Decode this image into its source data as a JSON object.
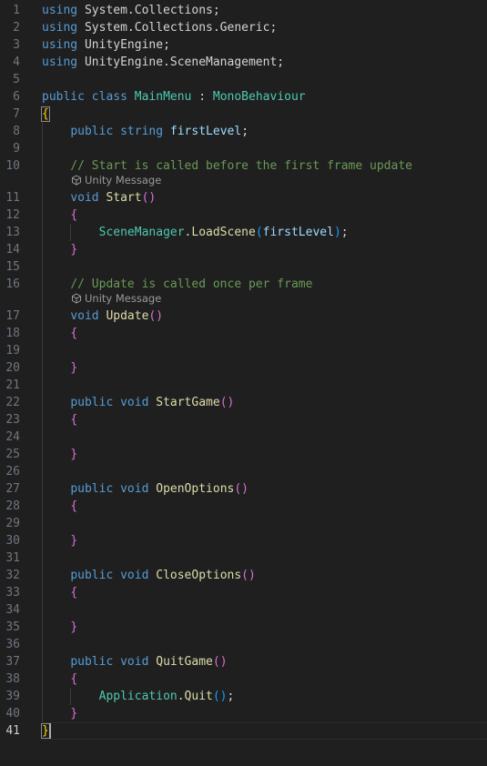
{
  "editor": {
    "active_line": 41,
    "codelens_label": "Unity Message",
    "lines": [
      {
        "n": 1,
        "tokens": [
          [
            "using",
            "kw"
          ],
          [
            " ",
            "pl"
          ],
          [
            "System.Collections",
            "pl"
          ],
          [
            ";",
            "pl"
          ]
        ]
      },
      {
        "n": 2,
        "tokens": [
          [
            "using",
            "kw"
          ],
          [
            " ",
            "pl"
          ],
          [
            "System.Collections.Generic",
            "pl"
          ],
          [
            ";",
            "pl"
          ]
        ]
      },
      {
        "n": 3,
        "tokens": [
          [
            "using",
            "kw"
          ],
          [
            " ",
            "pl"
          ],
          [
            "UnityEngine",
            "pl"
          ],
          [
            ";",
            "pl"
          ]
        ]
      },
      {
        "n": 4,
        "tokens": [
          [
            "using",
            "kw"
          ],
          [
            " ",
            "pl"
          ],
          [
            "UnityEngine.SceneManagement",
            "pl"
          ],
          [
            ";",
            "pl"
          ]
        ]
      },
      {
        "n": 5,
        "tokens": []
      },
      {
        "n": 6,
        "tokens": [
          [
            "public",
            "kw"
          ],
          [
            " ",
            "pl"
          ],
          [
            "class",
            "kw"
          ],
          [
            " ",
            "pl"
          ],
          [
            "MainMenu",
            "ty"
          ],
          [
            " : ",
            "pl"
          ],
          [
            "MonoBehaviour",
            "ty"
          ]
        ]
      },
      {
        "n": 7,
        "tokens": [
          [
            "{",
            "br1 bm"
          ]
        ]
      },
      {
        "n": 8,
        "tokens": [
          [
            "    ",
            "pl"
          ],
          [
            "public",
            "kw"
          ],
          [
            " ",
            "pl"
          ],
          [
            "string",
            "kw"
          ],
          [
            " ",
            "pl"
          ],
          [
            "firstLevel",
            "id"
          ],
          [
            ";",
            "pl"
          ]
        ]
      },
      {
        "n": 9,
        "tokens": []
      },
      {
        "n": 10,
        "tokens": [
          [
            "    ",
            "pl"
          ],
          [
            "// Start is called before the first frame update",
            "cm"
          ]
        ],
        "codelens": true
      },
      {
        "n": 11,
        "tokens": [
          [
            "    ",
            "pl"
          ],
          [
            "void",
            "kw"
          ],
          [
            " ",
            "pl"
          ],
          [
            "Start",
            "fn"
          ],
          [
            "()",
            "br2"
          ]
        ]
      },
      {
        "n": 12,
        "tokens": [
          [
            "    ",
            "pl"
          ],
          [
            "{",
            "br2"
          ]
        ]
      },
      {
        "n": 13,
        "tokens": [
          [
            "        ",
            "pl"
          ],
          [
            "SceneManager",
            "ty"
          ],
          [
            ".",
            "pl"
          ],
          [
            "LoadScene",
            "fn"
          ],
          [
            "(",
            "br3"
          ],
          [
            "firstLevel",
            "id"
          ],
          [
            ")",
            "br3"
          ],
          [
            ";",
            "pl"
          ]
        ]
      },
      {
        "n": 14,
        "tokens": [
          [
            "    ",
            "pl"
          ],
          [
            "}",
            "br2"
          ]
        ]
      },
      {
        "n": 15,
        "tokens": []
      },
      {
        "n": 16,
        "tokens": [
          [
            "    ",
            "pl"
          ],
          [
            "// Update is called once per frame",
            "cm"
          ]
        ],
        "codelens": true
      },
      {
        "n": 17,
        "tokens": [
          [
            "    ",
            "pl"
          ],
          [
            "void",
            "kw"
          ],
          [
            " ",
            "pl"
          ],
          [
            "Update",
            "fn"
          ],
          [
            "()",
            "br2"
          ]
        ]
      },
      {
        "n": 18,
        "tokens": [
          [
            "    ",
            "pl"
          ],
          [
            "{",
            "br2"
          ]
        ]
      },
      {
        "n": 19,
        "tokens": []
      },
      {
        "n": 20,
        "tokens": [
          [
            "    ",
            "pl"
          ],
          [
            "}",
            "br2"
          ]
        ]
      },
      {
        "n": 21,
        "tokens": []
      },
      {
        "n": 22,
        "tokens": [
          [
            "    ",
            "pl"
          ],
          [
            "public",
            "kw"
          ],
          [
            " ",
            "pl"
          ],
          [
            "void",
            "kw"
          ],
          [
            " ",
            "pl"
          ],
          [
            "StartGame",
            "fn"
          ],
          [
            "()",
            "br2"
          ]
        ]
      },
      {
        "n": 23,
        "tokens": [
          [
            "    ",
            "pl"
          ],
          [
            "{",
            "br2"
          ]
        ]
      },
      {
        "n": 24,
        "tokens": []
      },
      {
        "n": 25,
        "tokens": [
          [
            "    ",
            "pl"
          ],
          [
            "}",
            "br2"
          ]
        ]
      },
      {
        "n": 26,
        "tokens": []
      },
      {
        "n": 27,
        "tokens": [
          [
            "    ",
            "pl"
          ],
          [
            "public",
            "kw"
          ],
          [
            " ",
            "pl"
          ],
          [
            "void",
            "kw"
          ],
          [
            " ",
            "pl"
          ],
          [
            "OpenOptions",
            "fn"
          ],
          [
            "()",
            "br2"
          ]
        ]
      },
      {
        "n": 28,
        "tokens": [
          [
            "    ",
            "pl"
          ],
          [
            "{",
            "br2"
          ]
        ]
      },
      {
        "n": 29,
        "tokens": []
      },
      {
        "n": 30,
        "tokens": [
          [
            "    ",
            "pl"
          ],
          [
            "}",
            "br2"
          ]
        ]
      },
      {
        "n": 31,
        "tokens": []
      },
      {
        "n": 32,
        "tokens": [
          [
            "    ",
            "pl"
          ],
          [
            "public",
            "kw"
          ],
          [
            " ",
            "pl"
          ],
          [
            "void",
            "kw"
          ],
          [
            " ",
            "pl"
          ],
          [
            "CloseOptions",
            "fn"
          ],
          [
            "()",
            "br2"
          ]
        ]
      },
      {
        "n": 33,
        "tokens": [
          [
            "    ",
            "pl"
          ],
          [
            "{",
            "br2"
          ]
        ]
      },
      {
        "n": 34,
        "tokens": []
      },
      {
        "n": 35,
        "tokens": [
          [
            "    ",
            "pl"
          ],
          [
            "}",
            "br2"
          ]
        ]
      },
      {
        "n": 36,
        "tokens": []
      },
      {
        "n": 37,
        "tokens": [
          [
            "    ",
            "pl"
          ],
          [
            "public",
            "kw"
          ],
          [
            " ",
            "pl"
          ],
          [
            "void",
            "kw"
          ],
          [
            " ",
            "pl"
          ],
          [
            "QuitGame",
            "fn"
          ],
          [
            "()",
            "br2"
          ]
        ]
      },
      {
        "n": 38,
        "tokens": [
          [
            "    ",
            "pl"
          ],
          [
            "{",
            "br2"
          ]
        ]
      },
      {
        "n": 39,
        "tokens": [
          [
            "        ",
            "pl"
          ],
          [
            "Application",
            "ty"
          ],
          [
            ".",
            "pl"
          ],
          [
            "Quit",
            "fn"
          ],
          [
            "()",
            "br3"
          ],
          [
            ";",
            "pl"
          ]
        ]
      },
      {
        "n": 40,
        "tokens": [
          [
            "    ",
            "pl"
          ],
          [
            "}",
            "br2"
          ]
        ]
      },
      {
        "n": 41,
        "tokens": [
          [
            "}",
            "br1 bm"
          ]
        ]
      }
    ]
  },
  "colors": {
    "background": "#1f1f1f",
    "keyword": "#569cd6",
    "type": "#4ec9b0",
    "function": "#dcdcaa",
    "identifier": "#9cdcfe",
    "comment": "#6a9955",
    "bracket_level1": "#ffd700",
    "bracket_level2": "#da70d6",
    "bracket_level3": "#179fff"
  },
  "icons": {
    "codelens": "unity-cube-icon"
  }
}
